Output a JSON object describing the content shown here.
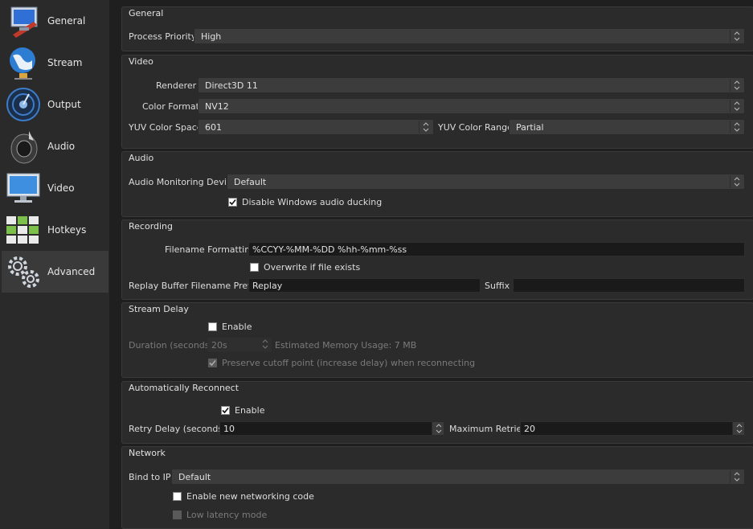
{
  "sidebar": {
    "items": [
      {
        "label": "General",
        "icon": "general-monitor-icon"
      },
      {
        "label": "Stream",
        "icon": "stream-globe-icon"
      },
      {
        "label": "Output",
        "icon": "output-broadcast-icon"
      },
      {
        "label": "Audio",
        "icon": "audio-speaker-icon"
      },
      {
        "label": "Video",
        "icon": "video-monitor-icon"
      },
      {
        "label": "Hotkeys",
        "icon": "hotkeys-keyboard-icon"
      },
      {
        "label": "Advanced",
        "icon": "advanced-gears-icon"
      }
    ],
    "active": "Advanced"
  },
  "general": {
    "title": "General",
    "process_priority_label": "Process Priority",
    "process_priority_value": "High"
  },
  "video": {
    "title": "Video",
    "renderer_label": "Renderer",
    "renderer_value": "Direct3D 11",
    "color_format_label": "Color Format",
    "color_format_value": "NV12",
    "yuv_space_label": "YUV Color Space",
    "yuv_space_value": "601",
    "yuv_range_label": "YUV Color Range",
    "yuv_range_value": "Partial"
  },
  "audio": {
    "title": "Audio",
    "monitoring_label": "Audio Monitoring Device",
    "monitoring_value": "Default",
    "ducking_label": "Disable Windows audio ducking",
    "ducking_checked": true
  },
  "recording": {
    "title": "Recording",
    "filename_label": "Filename Formatting",
    "filename_value": "%CCYY-%MM-%DD %hh-%mm-%ss",
    "overwrite_label": "Overwrite if file exists",
    "overwrite_checked": false,
    "replay_prefix_label": "Replay Buffer Filename Prefix",
    "replay_prefix_value": "Replay",
    "suffix_label": "Suffix",
    "suffix_value": ""
  },
  "stream_delay": {
    "title": "Stream Delay",
    "enable_label": "Enable",
    "enable_checked": false,
    "duration_label": "Duration (seconds)",
    "duration_value": "20s",
    "memory_label": "Estimated Memory Usage: 7 MB",
    "preserve_label": "Preserve cutoff point (increase delay) when reconnecting",
    "preserve_checked": true
  },
  "reconnect": {
    "title": "Automatically Reconnect",
    "enable_label": "Enable",
    "enable_checked": true,
    "retry_delay_label": "Retry Delay (seconds)",
    "retry_delay_value": "10",
    "max_retries_label": "Maximum Retries",
    "max_retries_value": "20"
  },
  "network": {
    "title": "Network",
    "bind_label": "Bind to IP",
    "bind_value": "Default",
    "new_networking_label": "Enable new networking code",
    "new_networking_checked": false,
    "low_latency_label": "Low latency mode",
    "low_latency_checked": false
  }
}
